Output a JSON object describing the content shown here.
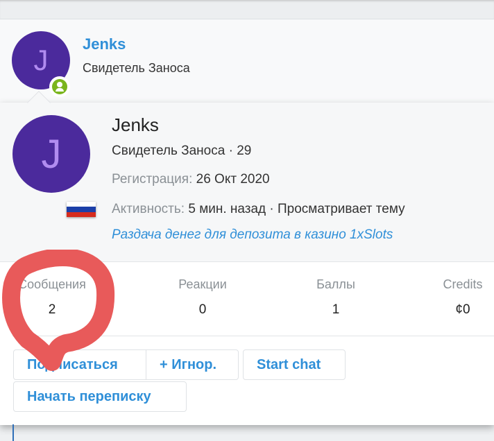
{
  "card": {
    "avatar_letter": "J",
    "name": "Jenks",
    "user_title": "Свидетель Заноса"
  },
  "popup": {
    "avatar_letter": "J",
    "name": "Jenks",
    "title_line": "Свидетель Заноса · 29",
    "registration_label": "Регистрация:",
    "registration_value": "26 Окт 2020",
    "activity_label": "Активность:",
    "activity_value": "5 мин. назад · Просматривает тему",
    "thread_link": "Раздача денег для депозита в казино 1xSlots",
    "stats": [
      {
        "label": "Сообщения",
        "value": "2"
      },
      {
        "label": "Реакции",
        "value": "0"
      },
      {
        "label": "Баллы",
        "value": "1"
      },
      {
        "label": "Credits",
        "value": "¢0"
      }
    ],
    "buttons": {
      "follow": "Подписаться",
      "ignore": "+ Игнор.",
      "start_chat": "Start chat",
      "start_conversation": "Начать переписку"
    }
  },
  "colors": {
    "accent": "#2f8fd8",
    "avatar_bg": "#4b2a9c",
    "online": "#7ab51d",
    "annotation": "#e85a5a"
  }
}
